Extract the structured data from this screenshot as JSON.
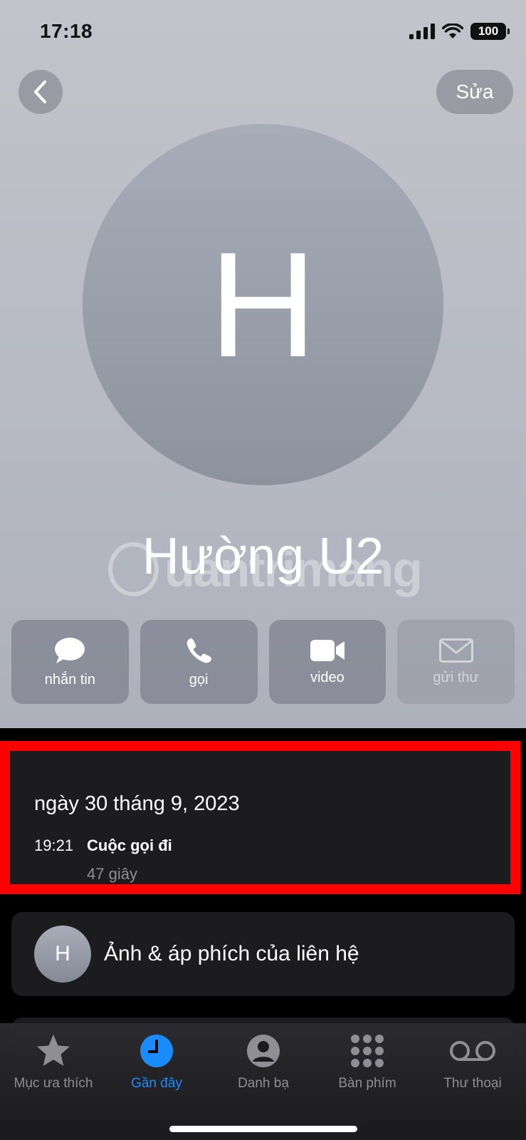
{
  "status": {
    "time": "17:18",
    "battery": "100"
  },
  "nav": {
    "edit_label": "Sửa"
  },
  "contact": {
    "initial": "H",
    "name": "Hường U2",
    "watermark": "uantrimang"
  },
  "actions": [
    {
      "label": "nhắn tin",
      "icon": "message-bubble-icon",
      "enabled": true
    },
    {
      "label": "gọi",
      "icon": "phone-icon",
      "enabled": true
    },
    {
      "label": "video",
      "icon": "video-camera-icon",
      "enabled": true
    },
    {
      "label": "gửi thư",
      "icon": "envelope-icon",
      "enabled": false
    }
  ],
  "recent_call": {
    "date": "ngày 30 tháng 9, 2023",
    "time": "19:21",
    "type": "Cuộc gọi đi",
    "duration": "47 giây"
  },
  "poster": {
    "initial": "H",
    "label": "Ảnh & áp phích của liên hệ"
  },
  "tabs": [
    {
      "label": "Mục ưa thích",
      "icon": "star-icon",
      "active": false
    },
    {
      "label": "Gần đây",
      "icon": "clock-icon",
      "active": true
    },
    {
      "label": "Danh bạ",
      "icon": "person-circle-icon",
      "active": false
    },
    {
      "label": "Bàn phím",
      "icon": "keypad-icon",
      "active": false
    },
    {
      "label": "Thư thoại",
      "icon": "voicemail-icon",
      "active": false
    }
  ],
  "colors": {
    "accent": "#1a8cff",
    "highlight": "#ff0000",
    "card": "#1c1c1e",
    "secondary_text": "#8e8e93"
  }
}
